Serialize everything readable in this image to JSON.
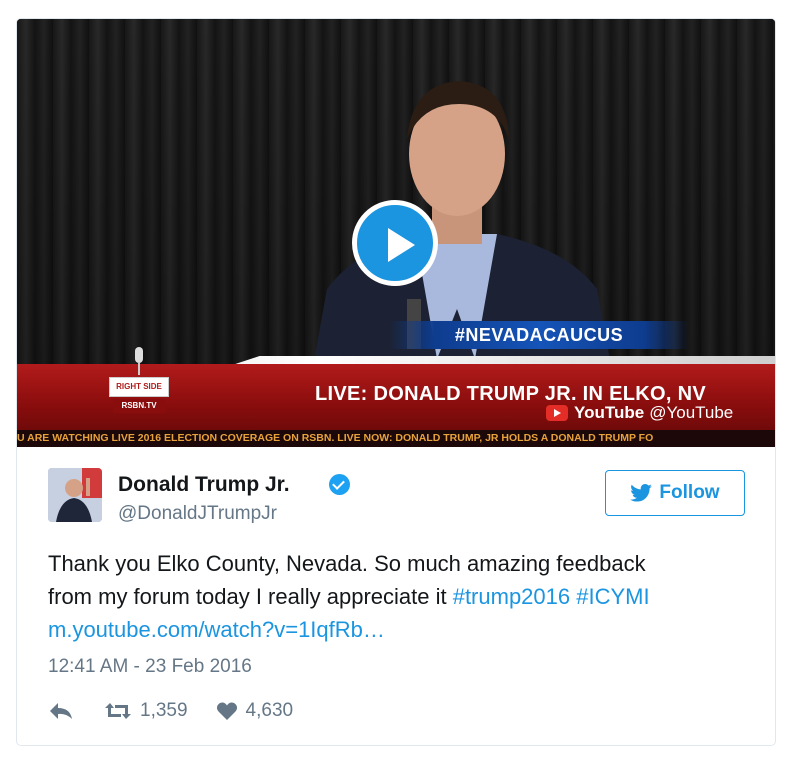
{
  "video": {
    "hashtag_banner": "#NEVADACAUCUS",
    "live_caption": "LIVE: DONALD TRUMP JR.  IN ELKO, NV",
    "ticker": "U ARE WATCHING LIVE 2016 ELECTION COVERAGE ON RSBN.    LIVE NOW: DONALD TRUMP, JR HOLDS A DONALD TRUMP FO",
    "logo_top": "RIGHT SIDE",
    "logo_bottom": "RSBN.TV",
    "source_name": "YouTube",
    "source_handle": "@YouTube"
  },
  "author": {
    "name": "Donald Trump Jr.",
    "handle": "@DonaldJTrumpJr",
    "verified": true
  },
  "follow_label": "Follow",
  "tweet": {
    "text_line1": "Thank you Elko County, Nevada. So much amazing feedback",
    "text_line2_plain": "from my forum today I really appreciate it ",
    "hashtag1": "#trump2016",
    "hashtag2": "#ICYMI",
    "link": "m.youtube.com/watch?v=1IqfRb…",
    "timestamp": "12:41 AM - 23 Feb 2016"
  },
  "stats": {
    "retweets": "1,359",
    "likes": "4,630"
  },
  "colors": {
    "accent": "#1b95e0",
    "text": "#14171a",
    "muted": "#657786",
    "verified": "#1da1f2"
  }
}
